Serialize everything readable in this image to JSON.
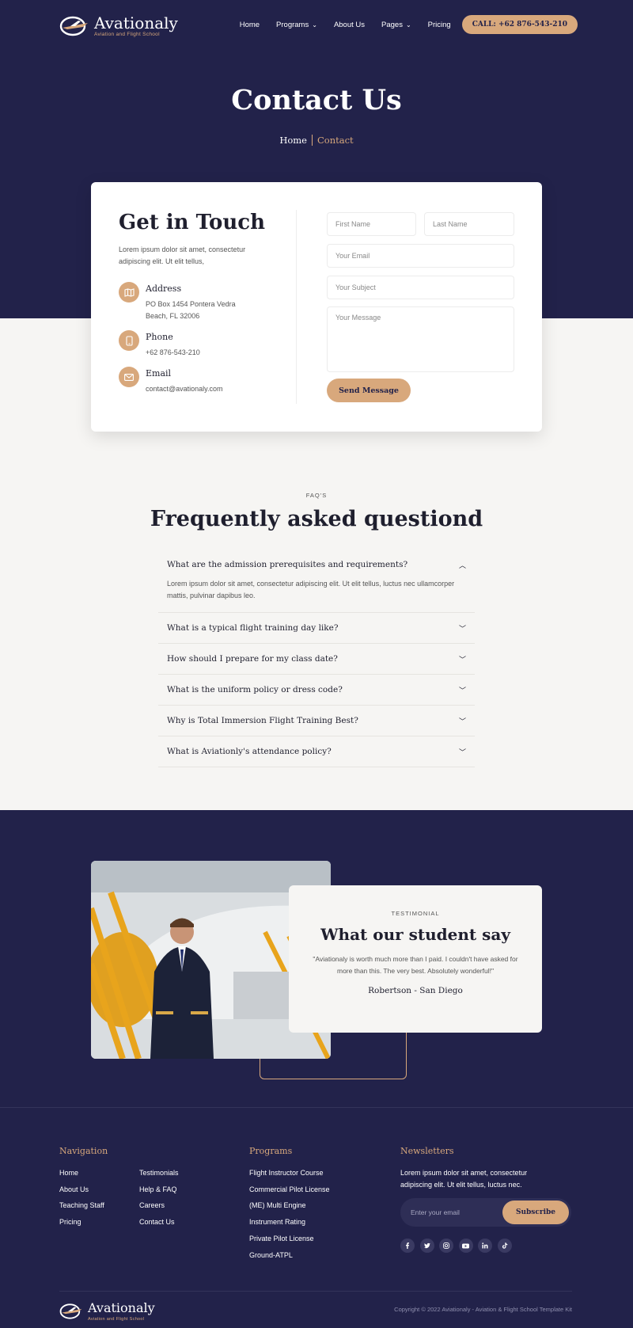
{
  "brand": {
    "name": "Avationaly",
    "tagline": "Aviation and Flight School"
  },
  "nav": {
    "items": [
      {
        "label": "Home",
        "has_dropdown": false
      },
      {
        "label": "Programs",
        "has_dropdown": true
      },
      {
        "label": "About Us",
        "has_dropdown": false
      },
      {
        "label": "Pages",
        "has_dropdown": true
      },
      {
        "label": "Pricing",
        "has_dropdown": false
      }
    ],
    "call_label": "CALL: +62 876-543-210"
  },
  "hero": {
    "title": "Contact Us",
    "breadcrumb": {
      "home": "Home",
      "current": "Contact"
    }
  },
  "contact": {
    "title": "Get in Touch",
    "text": "Lorem ipsum dolor sit amet, consectetur adipiscing elit. Ut elit tellus,",
    "address": {
      "title": "Address",
      "value": "PO Box 1454 Pontera Vedra Beach, FL 32006",
      "icon": "map-icon"
    },
    "phone": {
      "title": "Phone",
      "value": "+62 876-543-210",
      "icon": "phone-icon"
    },
    "email": {
      "title": "Email",
      "value": "contact@avationaly.com",
      "icon": "mail-icon"
    },
    "form": {
      "first_name": "First Name",
      "last_name": "Last Name",
      "email": "Your Email",
      "subject": "Your Subject",
      "message": "Your Message",
      "submit": "Send Message"
    }
  },
  "faq": {
    "eyebrow": "FAQ'S",
    "title": "Frequently asked questiond",
    "items": [
      {
        "q": "What are the admission prerequisites and requirements?",
        "a": "Lorem ipsum dolor sit amet, consectetur adipiscing elit. Ut elit tellus, luctus nec ullamcorper mattis, pulvinar dapibus leo.",
        "open": true
      },
      {
        "q": "What is a typical flight training day like?",
        "open": false
      },
      {
        "q": "How should I prepare for my class date?",
        "open": false
      },
      {
        "q": "What is the uniform policy or dress code?",
        "open": false
      },
      {
        "q": "Why is Total Immersion Flight Training Best?",
        "open": false
      },
      {
        "q": "What is Aviationly's attendance policy?",
        "open": false
      }
    ]
  },
  "testimonial": {
    "eyebrow": "TESTIMONIAL",
    "title": "What our student say",
    "quote": "\"Aviationaly is worth much more than I paid. I couldn't have asked for more than this. The very best. Absolutely wonderful!\"",
    "author": "Robertson - San Diego"
  },
  "footer": {
    "navigation": {
      "title": "Navigation",
      "col1": [
        "Home",
        "About Us",
        "Teaching Staff",
        "Pricing"
      ],
      "col2": [
        "Testimonials",
        "Help & FAQ",
        "Careers",
        "Contact Us"
      ]
    },
    "programs": {
      "title": "Programs",
      "items": [
        "Flight Instructor Course",
        "Commercial Pilot License",
        "(ME) Multi Engine",
        "Instrument Rating",
        "Private Pilot License",
        "Ground-ATPL"
      ]
    },
    "newsletter": {
      "title": "Newsletters",
      "text": "Lorem ipsum dolor sit amet, consectetur adipiscing elit. Ut elit tellus, luctus nec.",
      "placeholder": "Enter your email",
      "button": "Subscribe",
      "socials": [
        "facebook-icon",
        "twitter-icon",
        "instagram-icon",
        "youtube-icon",
        "linkedin-icon",
        "tiktok-icon"
      ]
    },
    "copyright": "Copyright © 2022 Aviationaly - Aviation & Flight School Template Kit"
  },
  "colors": {
    "navy": "#22224a",
    "accent": "#d8a87c",
    "light_bg": "#f6f5f3"
  }
}
